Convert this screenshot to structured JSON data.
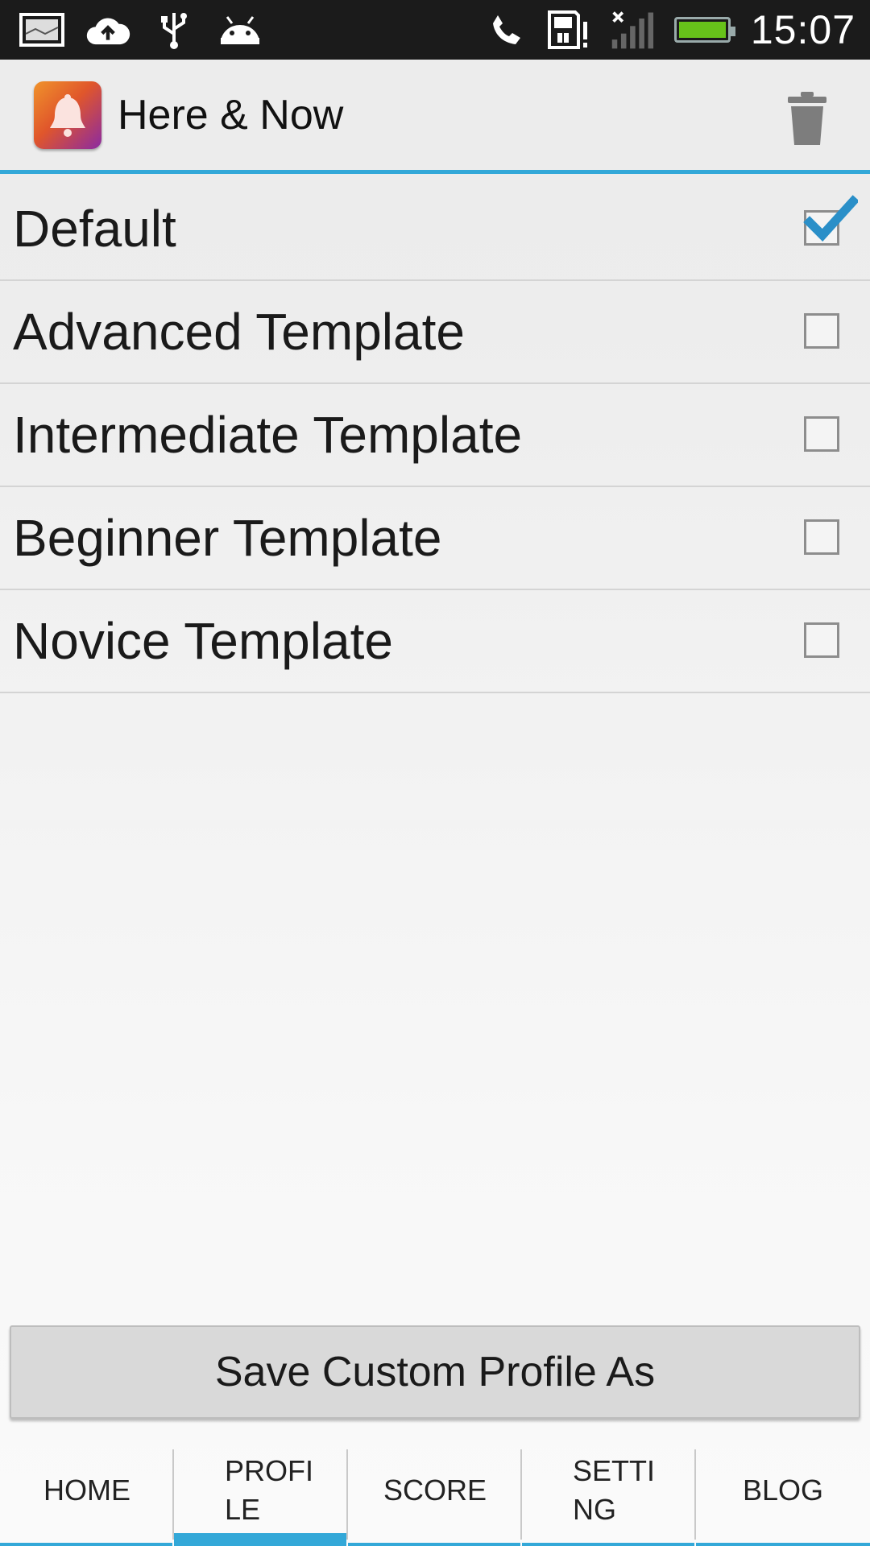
{
  "status_bar": {
    "time": "15:07",
    "left_icons": [
      "gallery-notification-icon",
      "cloud-upload-icon",
      "usb-icon",
      "android-debug-icon"
    ],
    "right_icons": [
      "phone-call-icon",
      "sd-card-warning-icon",
      "no-signal-icon",
      "battery-icon"
    ],
    "battery_level": 1.0
  },
  "action_bar": {
    "title": "Here & Now",
    "app_icon": "bell-app-icon",
    "action_icon": "trash-icon",
    "accent_color": "#33a8d8"
  },
  "profiles": [
    {
      "label": "Default",
      "checked": true
    },
    {
      "label": "Advanced Template",
      "checked": false
    },
    {
      "label": "Intermediate Template",
      "checked": false
    },
    {
      "label": "Beginner Template",
      "checked": false
    },
    {
      "label": "Novice Template",
      "checked": false
    }
  ],
  "save_button": {
    "label": "Save Custom Profile As"
  },
  "tabs": [
    {
      "line1": "HOME",
      "line2": "",
      "active": false
    },
    {
      "line1": "PROFI",
      "line2": "LE",
      "active": true
    },
    {
      "line1": "SCORE",
      "line2": "",
      "active": false
    },
    {
      "line1": "SETTI",
      "line2": "NG",
      "active": false
    },
    {
      "line1": "BLOG",
      "line2": "",
      "active": false
    }
  ]
}
